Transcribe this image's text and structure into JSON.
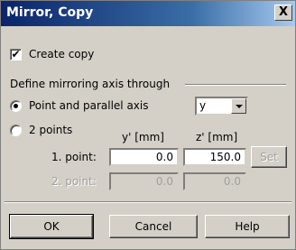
{
  "window": {
    "title": "Mirror, Copy",
    "close_label": "X"
  },
  "create_copy": {
    "label": "Create copy",
    "checked": true,
    "mark": "✔"
  },
  "group": {
    "title": "Define mirroring axis through"
  },
  "options": {
    "point_parallel": {
      "label": "Point and parallel axis",
      "selected": true
    },
    "two_points": {
      "label": "2 points",
      "selected": false
    }
  },
  "axis_select": {
    "value": "y"
  },
  "columns": {
    "y": "y' [mm]",
    "z": "z' [mm]"
  },
  "rows": {
    "point1": {
      "label": "1. point:",
      "y": "0.0",
      "z": "150.0",
      "set_label": "Set"
    },
    "point2": {
      "label": "2. point:",
      "y": "0.0",
      "z": "0.0"
    }
  },
  "buttons": {
    "ok": "OK",
    "cancel": "Cancel",
    "help": "Help"
  }
}
